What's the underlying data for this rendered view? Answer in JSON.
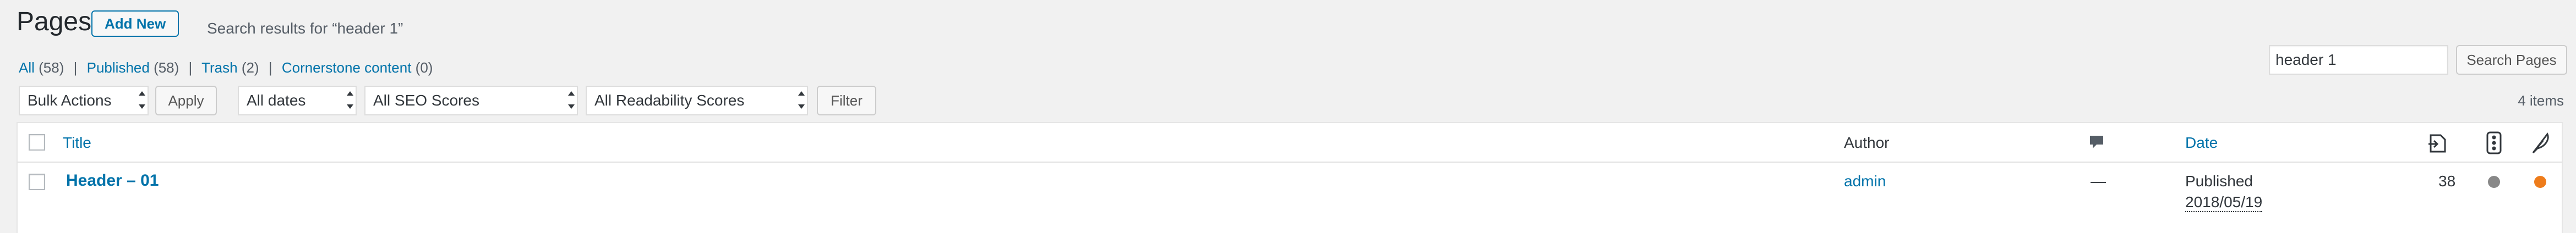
{
  "header": {
    "title": "Pages",
    "add_new_label": "Add New",
    "search_results_text": "Search results for “header 1”"
  },
  "views": {
    "all_label": "All",
    "all_count": "(58)",
    "published_label": "Published",
    "published_count": "(58)",
    "trash_label": "Trash",
    "trash_count": "(2)",
    "cornerstone_label": "Cornerstone content",
    "cornerstone_count": "(0)",
    "separator": "|"
  },
  "search": {
    "value": "header 1",
    "button_label": "Search Pages"
  },
  "tablenav": {
    "bulk_actions": "Bulk Actions",
    "apply_label": "Apply",
    "dates": "All dates",
    "seo_scores": "All SEO Scores",
    "readability_scores": "All Readability Scores",
    "filter_label": "Filter",
    "items_count": "4 items"
  },
  "table": {
    "columns": {
      "title": "Title",
      "author": "Author",
      "date": "Date"
    },
    "rows": [
      {
        "title": "Header – 01",
        "author": "admin",
        "comments": "—",
        "status": "Published",
        "date": "2018/05/19",
        "links": "38",
        "seo_color": "#888888",
        "readability_color": "#ee7c1b"
      }
    ]
  },
  "icons": {
    "comments": "comment-bubble-icon",
    "outgoing_links": "outgoing-links-icon",
    "readability": "traffic-light-icon",
    "seo": "feather-icon"
  }
}
